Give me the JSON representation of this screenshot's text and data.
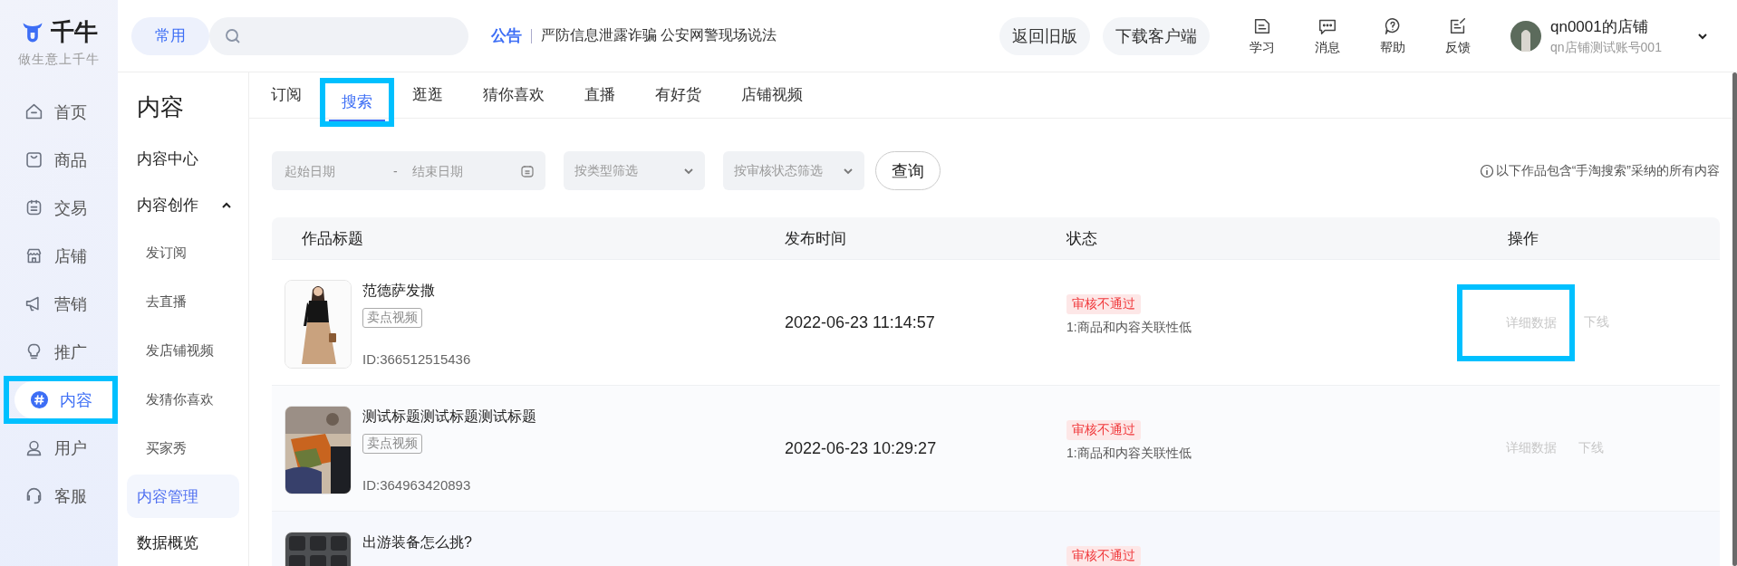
{
  "logo": {
    "name": "千牛",
    "slogan": "做生意上千牛"
  },
  "header": {
    "quick_button": "常用",
    "notice": {
      "label": "公告",
      "text": "严防信息泄露诈骗 公安网警现场说法"
    },
    "buttons": [
      "返回旧版",
      "下载客户端"
    ],
    "tools": [
      {
        "label": "学习"
      },
      {
        "label": "消息"
      },
      {
        "label": "帮助"
      },
      {
        "label": "反馈"
      }
    ],
    "account": {
      "name": "qn0001的店铺",
      "subtitle": "qn店铺测试账号001"
    }
  },
  "nav": [
    {
      "label": "首页",
      "selected": false,
      "highlighted": false
    },
    {
      "label": "商品",
      "selected": false,
      "highlighted": false
    },
    {
      "label": "交易",
      "selected": false,
      "highlighted": false
    },
    {
      "label": "店铺",
      "selected": false,
      "highlighted": false
    },
    {
      "label": "营销",
      "selected": false,
      "highlighted": false
    },
    {
      "label": "推广",
      "selected": false,
      "highlighted": false
    },
    {
      "label": "内容",
      "selected": true,
      "highlighted": true
    },
    {
      "label": "用户",
      "selected": false,
      "highlighted": false
    },
    {
      "label": "客服",
      "selected": false,
      "highlighted": false
    }
  ],
  "subnav": {
    "title": "内容",
    "items": [
      {
        "label": "内容中心",
        "selected": false
      },
      {
        "label": "内容创作",
        "selected": false,
        "expanded": true,
        "children": [
          {
            "label": "发订阅",
            "selected": false
          },
          {
            "label": "去直播",
            "selected": false
          },
          {
            "label": "发店铺视频",
            "selected": false
          },
          {
            "label": "发猜你喜欢",
            "selected": false
          },
          {
            "label": "买家秀",
            "selected": false
          }
        ]
      },
      {
        "label": "内容管理",
        "selected": true
      },
      {
        "label": "数据概览",
        "selected": false
      }
    ]
  },
  "tabs": [
    {
      "label": "订阅",
      "selected": false,
      "highlighted": false
    },
    {
      "label": "搜索",
      "selected": true,
      "highlighted": true
    },
    {
      "label": "逛逛",
      "selected": false,
      "highlighted": false
    },
    {
      "label": "猜你喜欢",
      "selected": false,
      "highlighted": false
    },
    {
      "label": "直播",
      "selected": false,
      "highlighted": false
    },
    {
      "label": "有好货",
      "selected": false,
      "highlighted": false
    },
    {
      "label": "店铺视频",
      "selected": false,
      "highlighted": false
    }
  ],
  "filters": {
    "start_placeholder": "起始日期",
    "separator": "-",
    "end_placeholder": "结束日期",
    "type_select": "按类型筛选",
    "status_select": "按审核状态筛选",
    "query_button": "查询"
  },
  "info": "以下作品包含“手淘搜索”采纳的所有内容",
  "table": {
    "columns": [
      "作品标题",
      "发布时间",
      "状态",
      "操作"
    ],
    "rows": [
      {
        "thumbnail": {
          "kind": "picture"
        },
        "title": "范德萨发撒",
        "tag": "卖点视频",
        "id": "ID:366512515436",
        "time": "2022-06-23 11:14:57",
        "status": "审核不通过",
        "reason": "1:商品和内容关联性低",
        "actions": [
          {
            "label": "详细数据",
            "disabled": true,
            "highlighted": true
          },
          {
            "label": "下线",
            "disabled": true,
            "highlighted": false
          }
        ]
      },
      {
        "thumbnail": {
          "kind": "picture"
        },
        "title": "测试标题测试标题测试标题",
        "tag": "卖点视频",
        "id": "ID:364963420893",
        "time": "2022-06-23 10:29:27",
        "status": "审核不通过",
        "reason": "1:商品和内容关联性低",
        "actions": [
          {
            "label": "详细数据",
            "disabled": true,
            "highlighted": false
          },
          {
            "label": "下线",
            "disabled": true,
            "highlighted": false
          }
        ]
      },
      {
        "thumbnail": {
          "kind": "picture"
        },
        "title": "出游装备怎么挑?",
        "status": "审核不通过"
      }
    ]
  }
}
